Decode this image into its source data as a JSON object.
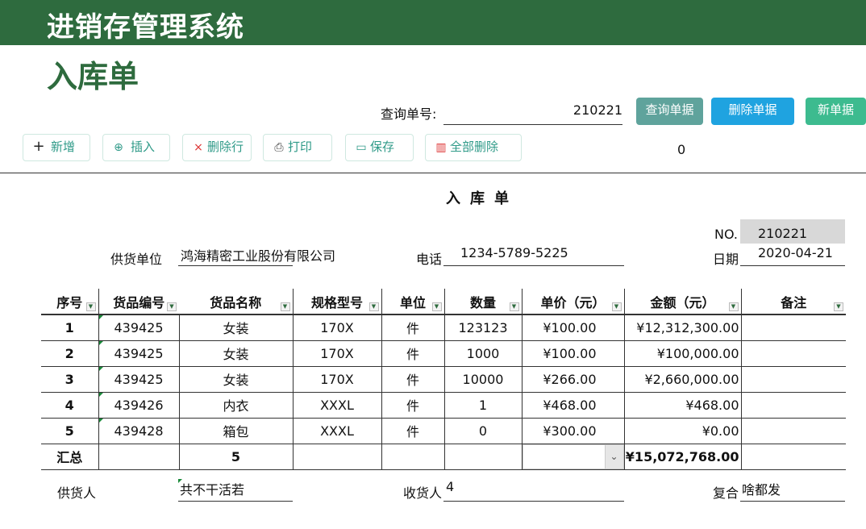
{
  "app": {
    "title": "进销存管理系统",
    "heading": "入库单"
  },
  "query": {
    "label": "查询单号:",
    "value": "210221"
  },
  "header_buttons": {
    "query": "查询单据",
    "delete": "删除单据",
    "new": "新单据"
  },
  "toolbar": {
    "add": "新增",
    "insert": "插入",
    "delete_row": "删除行",
    "print": "打印",
    "save": "保存",
    "delete_all": "全部删除",
    "counter": "0"
  },
  "doc": {
    "title": "入库单",
    "no_label": "NO.",
    "no_value": "210221",
    "supplier_label": "供货单位",
    "supplier_value": "鸿海精密工业股份有限公司",
    "phone_label": "电话",
    "phone_value": "1234-5789-5225",
    "date_label": "日期",
    "date_value": "2020-04-21"
  },
  "table": {
    "headers": [
      "序号",
      "货品编号",
      "货品名称",
      "规格型号",
      "单位",
      "数量",
      "单价（元）",
      "金额（元）",
      "备注"
    ],
    "rows": [
      [
        "1",
        "439425",
        "女装",
        "170X",
        "件",
        "123123",
        "¥100.00",
        "¥12,312,300.00",
        ""
      ],
      [
        "2",
        "439425",
        "女装",
        "170X",
        "件",
        "1000",
        "¥100.00",
        "¥100,000.00",
        ""
      ],
      [
        "3",
        "439425",
        "女装",
        "170X",
        "件",
        "10000",
        "¥266.00",
        "¥2,660,000.00",
        ""
      ],
      [
        "4",
        "439426",
        "内衣",
        "XXXL",
        "件",
        "1",
        "¥468.00",
        "¥468.00",
        ""
      ],
      [
        "5",
        "439428",
        "箱包",
        "XXXL",
        "件",
        "0",
        "¥300.00",
        "¥0.00",
        ""
      ]
    ],
    "total_label": "汇总",
    "total_count": "5",
    "total_amount": "¥15,072,768.00"
  },
  "footer": {
    "supplier_person_label": "供货人",
    "supplier_person_value": "共不干活若",
    "receiver_label": "收货人",
    "receiver_value": "4",
    "checker_label": "复合",
    "checker_value": "啥都发"
  },
  "colors": {
    "brand": "#2e6b3e",
    "query_btn": "#5fa39c",
    "delete_btn": "#1fa3e0",
    "new_btn": "#3dbb8f"
  },
  "icons": {
    "add": "plus-icon",
    "insert": "circle-plus-icon",
    "delete_row": "close-icon",
    "print": "printer-icon",
    "save": "save-icon",
    "delete_all": "trash-icon",
    "dropdown": "chevron-down-icon"
  }
}
